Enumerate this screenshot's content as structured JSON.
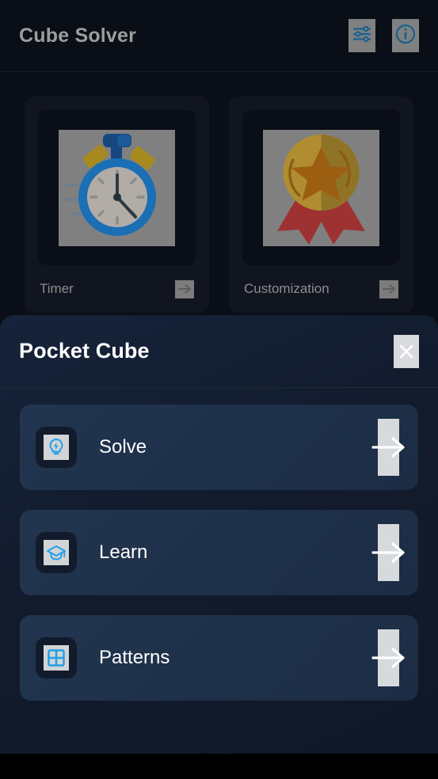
{
  "app": {
    "title": "Cube Solver",
    "accent_blue": "#1f9fe8",
    "header_icon_bg": "#808080",
    "header_icon_color": "#18628f"
  },
  "header": {
    "actions": [
      {
        "name": "settings-sliders-icon",
        "label": "Settings"
      },
      {
        "name": "info-icon",
        "label": "Info"
      }
    ]
  },
  "cards": [
    {
      "label": "Timer",
      "image": "stopwatch-illustration",
      "arrow": "arrow-right-icon"
    },
    {
      "label": "Customization",
      "image": "medal-illustration",
      "arrow": "arrow-right-icon"
    }
  ],
  "sheet": {
    "title": "Pocket Cube",
    "close_label": "×",
    "items": [
      {
        "label": "Solve",
        "icon": "lightbulb-bolt-icon"
      },
      {
        "label": "Learn",
        "icon": "graduation-cap-icon"
      },
      {
        "label": "Patterns",
        "icon": "grid-2x2-icon"
      }
    ]
  }
}
